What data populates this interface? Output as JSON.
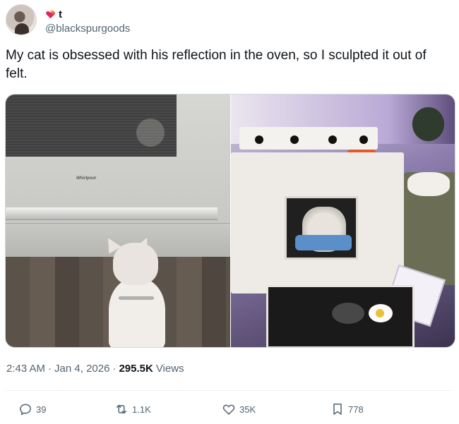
{
  "author": {
    "display_name": "t",
    "handle": "@blackspurgoods",
    "name_emoji": "heart-on-fire-icon"
  },
  "tweet": {
    "text": "My cat is obsessed with his reflection in the oven, so I sculpted it out of felt."
  },
  "media": {
    "left_photo_brand": "Whirlpool"
  },
  "meta": {
    "time": "2:43 AM",
    "separator": "·",
    "date": "Jan 4, 2026",
    "views_count": "295.5K",
    "views_label": "Views"
  },
  "actions": {
    "replies": "39",
    "reposts": "1.1K",
    "likes": "35K",
    "bookmarks": "778"
  },
  "colors": {
    "text_primary": "#0f1419",
    "text_secondary": "#536471",
    "border": "#cfd9de"
  }
}
